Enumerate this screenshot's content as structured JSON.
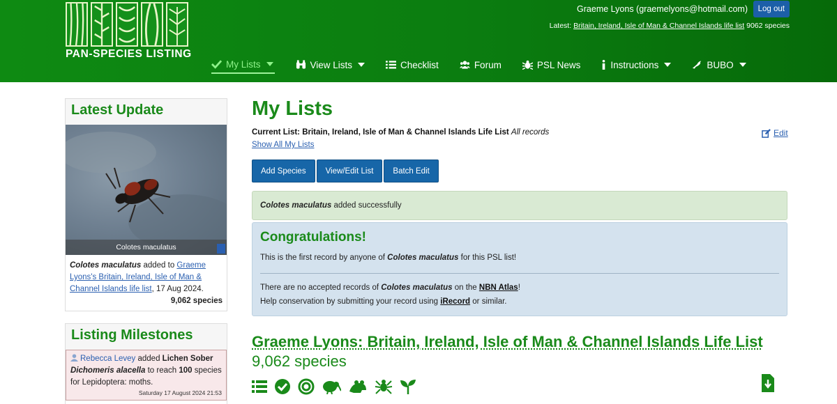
{
  "logo": {
    "text": "PAN-SPECIES LISTING"
  },
  "header": {
    "user": "Graeme Lyons (graemelyons@hotmail.com)",
    "logout_label": "Log out",
    "latest_prefix": "Latest:",
    "latest_link": "Britain, Ireland, Isle of Man & Channel Islands life list",
    "latest_count": "9062 species"
  },
  "nav": {
    "items": [
      {
        "label": "My Lists",
        "icon": "check-icon",
        "dropdown": true,
        "active": true
      },
      {
        "label": "View Lists",
        "icon": "binoculars-icon",
        "dropdown": true
      },
      {
        "label": "Checklist",
        "icon": "list-icon",
        "dropdown": false
      },
      {
        "label": "Forum",
        "icon": "users-icon",
        "dropdown": false
      },
      {
        "label": "PSL News",
        "icon": "bug-icon",
        "dropdown": false
      },
      {
        "label": "Instructions",
        "icon": "info-icon",
        "dropdown": true
      },
      {
        "label": "BUBO",
        "icon": "bird-icon",
        "dropdown": true
      }
    ]
  },
  "sidebar": {
    "latest_update": {
      "title": "Latest Update",
      "photo_caption": "Colotes maculatus",
      "species": "Colotes maculatus",
      "added_to": "added to",
      "link": "Graeme Lyons's Britain, Ireland, Isle of Man & Channel Islands life list",
      "date": ", 17 Aug 2024.",
      "count": "9,062 species"
    },
    "milestones": {
      "title": "Listing Milestones",
      "name": "Rebecca Levey",
      "added": "added",
      "common_name": "Lichen Sober",
      "species": "Dichomeris alacella",
      "to_reach": "to reach",
      "number": "100",
      "species_for": "species for Lepidoptera: moths.",
      "time": "Saturday 17 August 2024 21:53"
    }
  },
  "main": {
    "title": "My Lists",
    "current_list_label": "Current List: Britain, Ireland, Isle of Man & Channel Islands Life List",
    "current_list_filter": "All records",
    "show_all": "Show All My Lists",
    "edit": "Edit",
    "buttons": {
      "add": "Add Species",
      "view_edit": "View/Edit List",
      "batch": "Batch Edit"
    },
    "success": {
      "species": "Colotes maculatus",
      "text": "added successfully"
    },
    "congrats": {
      "title": "Congratulations!",
      "line1_pre": "This is the first record by anyone of",
      "line1_species": "Colotes maculatus",
      "line1_post": "for this PSL list!",
      "line2_pre": "There are no accepted records of",
      "line2_species": "Colotes maculatus",
      "line2_mid": "on the",
      "line2_link": "NBN Atlas",
      "line2_post": "!",
      "line3_pre": "Help conservation by submitting your record using",
      "line3_link": "iRecord",
      "line3_post": "or similar."
    },
    "list_title": "Graeme Lyons: Britain, Ireland, Isle of Man & Channel Islands Life List",
    "list_count": "9,062 species"
  },
  "colors": {
    "brand_green": "#0e8a12",
    "title_green": "#1a8a1a",
    "button_blue": "#1766a8",
    "link_blue": "#2a5fb0"
  }
}
